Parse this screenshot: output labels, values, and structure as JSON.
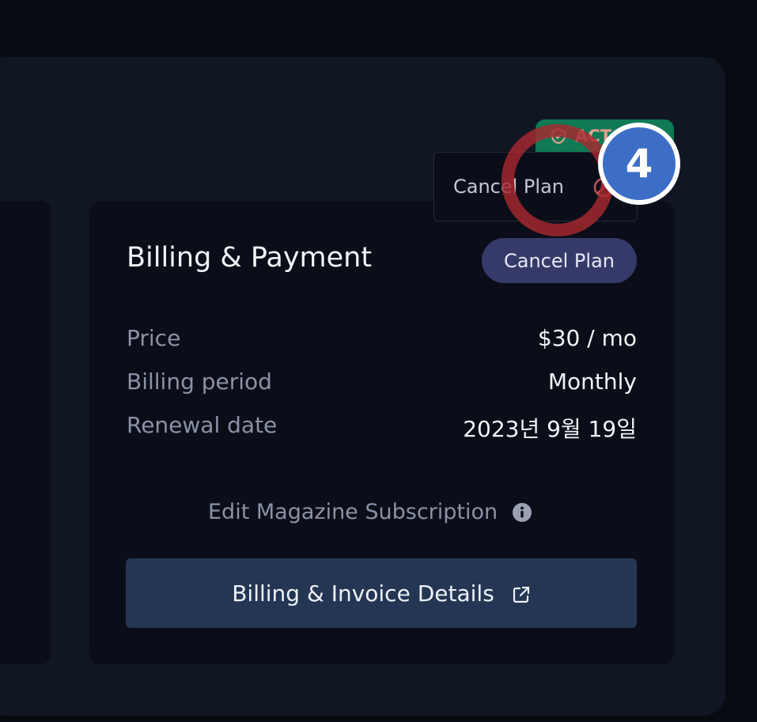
{
  "status_badge": {
    "label": "ACT"
  },
  "cancel_popup": {
    "label": "Cancel Plan"
  },
  "step_marker": {
    "number": "4"
  },
  "billing_card": {
    "title": "Billing & Payment",
    "cancel_button_label": "Cancel Plan",
    "rows": [
      {
        "label": "Price",
        "value": "$30 / mo"
      },
      {
        "label": "Billing period",
        "value": "Monthly"
      },
      {
        "label": "Renewal date",
        "value": "2023년 9월 19일"
      }
    ],
    "edit_link_label": "Edit Magazine Subscription",
    "invoice_button_label": "Billing & Invoice Details"
  },
  "icons": {
    "badge": "shield-check-icon",
    "popup": "cancel-circle-icon",
    "edit": "info-icon",
    "invoice": "external-link-icon"
  },
  "colors": {
    "background": "#090b13",
    "panel": "#111623",
    "card": "#0b0e18",
    "badge_green": "#0f7a54",
    "cancel_button": "#363a69",
    "invoice_button": "#243653",
    "highlight_ring": "#a72830",
    "step_marker": "#3d6ec6"
  }
}
